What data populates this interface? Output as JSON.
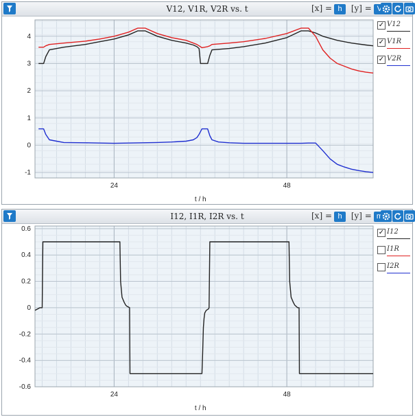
{
  "panels": [
    {
      "title": "V12, V1R, V2R vs. t",
      "x_prefix": "[x] =",
      "x_unit": "h",
      "y_prefix": "[y] =",
      "y_unit": "V",
      "legend": [
        {
          "label": "V12",
          "checked": true,
          "color": "#222222"
        },
        {
          "label": "V1R",
          "checked": true,
          "color": "#e02020"
        },
        {
          "label": "V2R",
          "checked": true,
          "color": "#1f2fd0"
        }
      ]
    },
    {
      "title": "I12, I1R, I2R vs. t",
      "x_prefix": "[x] =",
      "x_unit": "h",
      "y_prefix": "[y] =",
      "y_unit": "mA",
      "legend": [
        {
          "label": "I12",
          "checked": true,
          "color": "#222222"
        },
        {
          "label": "I1R",
          "checked": false,
          "color": "#e02020"
        },
        {
          "label": "I2R",
          "checked": false,
          "color": "#1f2fd0"
        }
      ]
    }
  ],
  "icons": [
    "pin-icon",
    "settings-gear-icon",
    "refresh-icon",
    "camera-icon"
  ],
  "chart_data": [
    {
      "type": "line",
      "title": "V12, V1R, V2R vs. t",
      "xlabel": "t / h",
      "ylabel": "",
      "xlim": [
        13,
        60
      ],
      "ylim": [
        -1.2,
        4.6
      ],
      "x_ticks": [
        24,
        48
      ],
      "y_ticks": [
        -1,
        0,
        1,
        2,
        3,
        4
      ],
      "grid": true,
      "legend_position": "right",
      "shaded_x": [
        [
          13,
          37
        ],
        [
          37,
          60
        ]
      ],
      "series": [
        {
          "name": "V12",
          "color": "#222222",
          "x": [
            13.5,
            14.2,
            14.5,
            15,
            17,
            20,
            22,
            24,
            26,
            27.3,
            28.3,
            30,
            32,
            34,
            35,
            35.5,
            35.8,
            36,
            37,
            37.3,
            37.6,
            38.5,
            40,
            42,
            45,
            48,
            50,
            51,
            52,
            53,
            55,
            57,
            59,
            60
          ],
          "y": [
            3.0,
            3.0,
            3.25,
            3.5,
            3.6,
            3.7,
            3.8,
            3.9,
            4.05,
            4.2,
            4.2,
            4.0,
            3.85,
            3.75,
            3.68,
            3.62,
            3.55,
            3.0,
            3.0,
            3.3,
            3.5,
            3.52,
            3.55,
            3.62,
            3.75,
            3.95,
            4.2,
            4.2,
            4.12,
            4.0,
            3.85,
            3.75,
            3.68,
            3.65
          ]
        },
        {
          "name": "V1R",
          "color": "#e02020",
          "x": [
            13.5,
            14.2,
            14.5,
            15,
            17,
            20,
            22,
            24,
            26,
            27.3,
            28.3,
            30,
            32,
            34,
            35,
            35.5,
            35.8,
            36.2,
            37,
            37.3,
            37.6,
            38.5,
            40,
            42,
            45,
            48,
            50,
            51,
            51.5,
            52,
            52.5,
            53,
            54,
            55,
            56,
            57,
            58,
            59,
            60
          ],
          "y": [
            3.6,
            3.6,
            3.65,
            3.7,
            3.75,
            3.82,
            3.9,
            4.0,
            4.15,
            4.3,
            4.3,
            4.1,
            3.95,
            3.85,
            3.75,
            3.7,
            3.65,
            3.58,
            3.62,
            3.65,
            3.7,
            3.72,
            3.75,
            3.8,
            3.92,
            4.1,
            4.3,
            4.3,
            4.15,
            4.0,
            3.75,
            3.5,
            3.2,
            3.0,
            2.9,
            2.8,
            2.73,
            2.68,
            2.65
          ]
        },
        {
          "name": "V2R",
          "color": "#1f2fd0",
          "x": [
            13.5,
            14.2,
            14.5,
            15,
            16,
            17,
            20,
            22,
            24,
            26,
            28,
            30,
            32,
            34,
            35,
            35.5,
            35.8,
            36.2,
            37,
            37.3,
            37.6,
            38.5,
            40,
            42,
            45,
            48,
            50,
            51,
            52,
            53,
            54,
            55,
            56,
            57,
            58,
            59,
            60
          ],
          "y": [
            0.6,
            0.6,
            0.4,
            0.2,
            0.15,
            0.1,
            0.09,
            0.08,
            0.07,
            0.08,
            0.09,
            0.1,
            0.12,
            0.15,
            0.2,
            0.28,
            0.4,
            0.6,
            0.6,
            0.35,
            0.2,
            0.12,
            0.09,
            0.07,
            0.07,
            0.07,
            0.07,
            0.08,
            0.08,
            -0.2,
            -0.5,
            -0.7,
            -0.8,
            -0.88,
            -0.93,
            -0.97,
            -1.0
          ]
        }
      ]
    },
    {
      "type": "line",
      "title": "I12, I1R, I2R vs. t",
      "xlabel": "t / h",
      "ylabel": "",
      "xlim": [
        13,
        60
      ],
      "ylim": [
        -0.6,
        0.62
      ],
      "x_ticks": [
        24,
        48
      ],
      "y_ticks": [
        -0.6,
        -0.4,
        -0.2,
        0,
        0.2,
        0.4,
        0.6
      ],
      "grid": true,
      "legend_position": "right",
      "shaded_x": [
        [
          13,
          37
        ],
        [
          37,
          60
        ]
      ],
      "series": [
        {
          "name": "I12",
          "color": "#222222",
          "x": [
            13,
            13.7,
            14,
            14.1,
            24.8,
            24.9,
            25.1,
            25.4,
            25.6,
            25.8,
            26,
            26.15,
            26.2,
            36.2,
            36.3,
            36.4,
            36.5,
            36.6,
            36.8,
            37.1,
            37.2,
            37.3,
            48.3,
            48.4,
            48.6,
            48.9,
            49.1,
            49.5,
            49.7,
            49.75,
            60
          ],
          "y": [
            -0.02,
            0.0,
            0.0,
            0.5,
            0.5,
            0.2,
            0.08,
            0.04,
            0.02,
            0.01,
            0.005,
            0.0,
            -0.5,
            -0.5,
            -0.35,
            -0.15,
            -0.08,
            -0.04,
            -0.02,
            -0.01,
            0.0,
            0.5,
            0.5,
            0.2,
            0.08,
            0.04,
            0.02,
            0.0,
            0.0,
            -0.5,
            -0.5
          ]
        }
      ]
    }
  ]
}
